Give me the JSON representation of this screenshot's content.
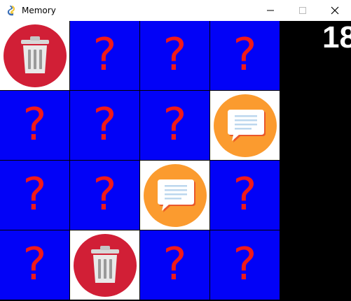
{
  "window": {
    "title": "Memory",
    "icon": "snake-icon",
    "controls": [
      "minimize-icon",
      "maximize-icon",
      "close-icon"
    ]
  },
  "game": {
    "score": "18",
    "rows": 4,
    "cols": 4,
    "hidden_glyph": "?",
    "colors": {
      "hidden_bg": "#0202f7",
      "question": "#f01a1a",
      "revealed_bg": "#ffffff",
      "panel": "#000000"
    },
    "cards": [
      [
        "trash-icon",
        "hidden",
        "hidden",
        "hidden"
      ],
      [
        "hidden",
        "hidden",
        "hidden",
        "chat-icon"
      ],
      [
        "hidden",
        "hidden",
        "chat-icon",
        "hidden"
      ],
      [
        "hidden",
        "trash-icon",
        "hidden",
        "hidden"
      ]
    ]
  }
}
